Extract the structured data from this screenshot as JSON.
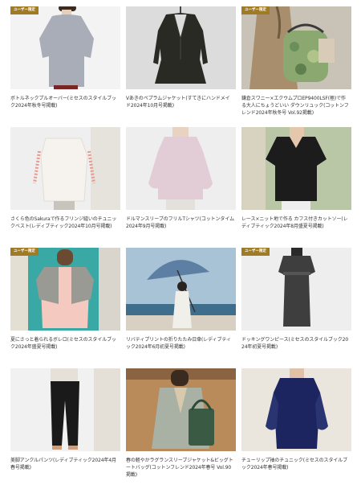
{
  "badge_color": "#a07b25",
  "items": [
    {
      "badge": "ユーザー限定",
      "caption": "ボトルネックプルオーバー(ミセスのスタイルブック2024年秋冬号掲載)",
      "bg": "#f3f3f3",
      "garment": "#a9adb8",
      "icon": "grey-pullover-photo"
    },
    {
      "badge": "",
      "caption": "Vあきのペプラムジャケット(すてきにハンドメイド2024年10月号掲載)",
      "bg": "#dcdcdc",
      "garment": "#2a2a24",
      "icon": "dark-peplum-jacket-photo"
    },
    {
      "badge": "ユーザー限定",
      "caption": "鎌倉スワニー×エクウムプロEP9400LSF(極)で作る大人にちょうどいい ダウンリュック(コットンフレンド2024年秋冬号 Vol.92掲載)",
      "bg": "#c9c2b6",
      "garment": "#8aa870",
      "icon": "backpack-photo"
    },
    {
      "badge": "",
      "caption": "さくら色のSakuraで作るフリンジ縫いのチュニックベスト(レディブティック2024年10月号掲載)",
      "bg": "#efefef",
      "garment": "#f6f3ee",
      "icon": "white-vest-photo"
    },
    {
      "badge": "",
      "caption": "ドルマンスリーブのフリルTシャツ(コットンタイム2024年9月号掲載)",
      "bg": "#eeeeee",
      "garment": "#e2ccd6",
      "icon": "pink-frill-tee-photo"
    },
    {
      "badge": "",
      "caption": "レース×ニット地で作る カフス付きカットソー(レディブティック2024年8月盛夏号掲載)",
      "bg": "#b9c7a6",
      "garment": "#1c1c1c",
      "icon": "black-lace-top-photo"
    },
    {
      "badge": "ユーザー限定",
      "caption": "夏にさっと着られるボレロ(ミセスのスタイルブック2024年盛夏号掲載)",
      "bg": "#3aa8a4",
      "garment": "#9a9a94",
      "icon": "bolero-photo"
    },
    {
      "badge": "",
      "caption": "リバティプリントの折りたたみ日傘(レディブティック2024年6月初夏号掲載)",
      "bg": "#a9c3d6",
      "garment": "#5d7fa3",
      "icon": "parasol-photo"
    },
    {
      "badge": "ユーザー限定",
      "caption": "ドッキングワンピース(ミセスのスタイルブック2024年初夏号掲載)",
      "bg": "#eeeeee",
      "garment": "#3e3e3e",
      "icon": "docking-dress-photo"
    },
    {
      "badge": "",
      "caption": "美脚アンクルパンツ(レディブティック2024年4月春号掲載)",
      "bg": "#f1f1f1",
      "garment": "#1a1a1a",
      "icon": "ankle-pants-photo"
    },
    {
      "badge": "",
      "caption": "春の軽やかラグランスリーブジャケット&ビッグトートバッグ(コットンフレンド2024年春号 Vol.90掲載)",
      "bg": "#b98a5a",
      "garment": "#a9b0a4",
      "icon": "raglan-jacket-bag-photo"
    },
    {
      "badge": "",
      "caption": "チューリップ袖のチュニック(ミセスのスタイルブック2024年春号掲載)",
      "bg": "#ebe6dd",
      "garment": "#1c2560",
      "icon": "navy-tunic-photo"
    }
  ]
}
